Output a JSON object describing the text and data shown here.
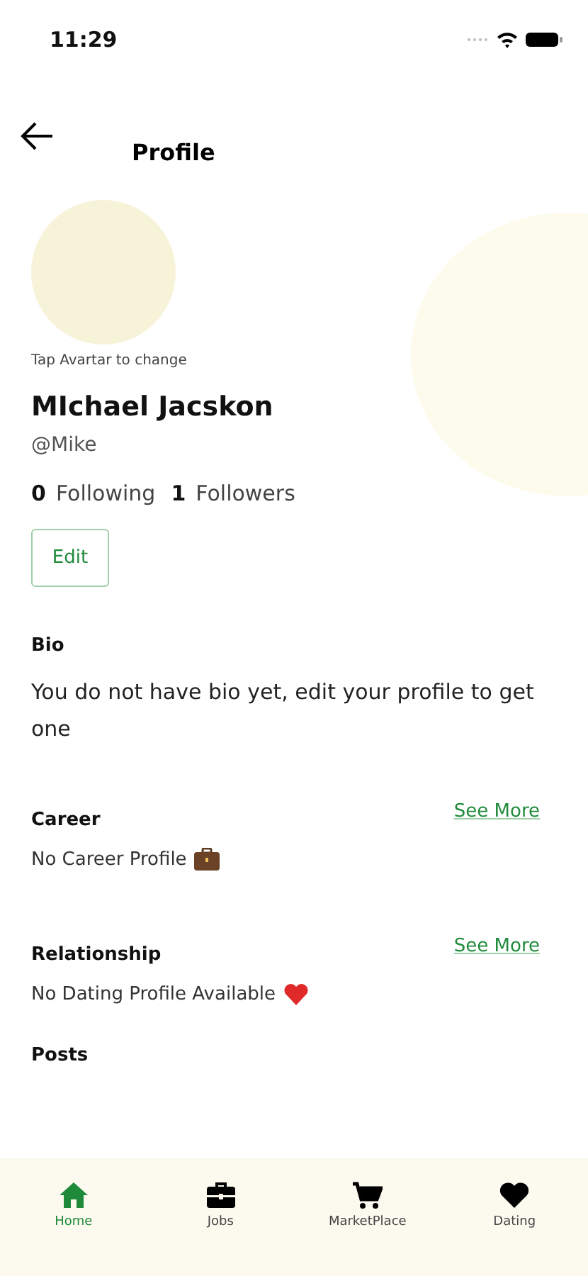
{
  "status_bar": {
    "time": "11:29"
  },
  "header": {
    "title": "Profile"
  },
  "avatar": {
    "hint": "Tap Avartar to change"
  },
  "profile": {
    "name": "MIchael Jacskon",
    "handle": "@Mike",
    "following_count": "0",
    "following_label": "Following",
    "followers_count": "1",
    "followers_label": "Followers",
    "edit_button": "Edit"
  },
  "bio": {
    "heading": "Bio",
    "text": "You do not have bio yet, edit your profile to get one"
  },
  "sections": [
    {
      "kind": "career",
      "heading": "Career",
      "link": "See More",
      "text": "No Career Profile"
    },
    {
      "kind": "dating",
      "heading": "Relationship",
      "link": "See More",
      "text": "No Dating Profile Available"
    }
  ],
  "posts": {
    "heading": "Posts"
  },
  "bottom_nav": [
    {
      "kind": "home",
      "label": "Home",
      "selected": true
    },
    {
      "kind": "jobs",
      "label": "Jobs",
      "selected": false
    },
    {
      "kind": "market",
      "label": "MarketPlace",
      "selected": false
    },
    {
      "kind": "dating",
      "label": "Dating",
      "selected": false
    }
  ]
}
